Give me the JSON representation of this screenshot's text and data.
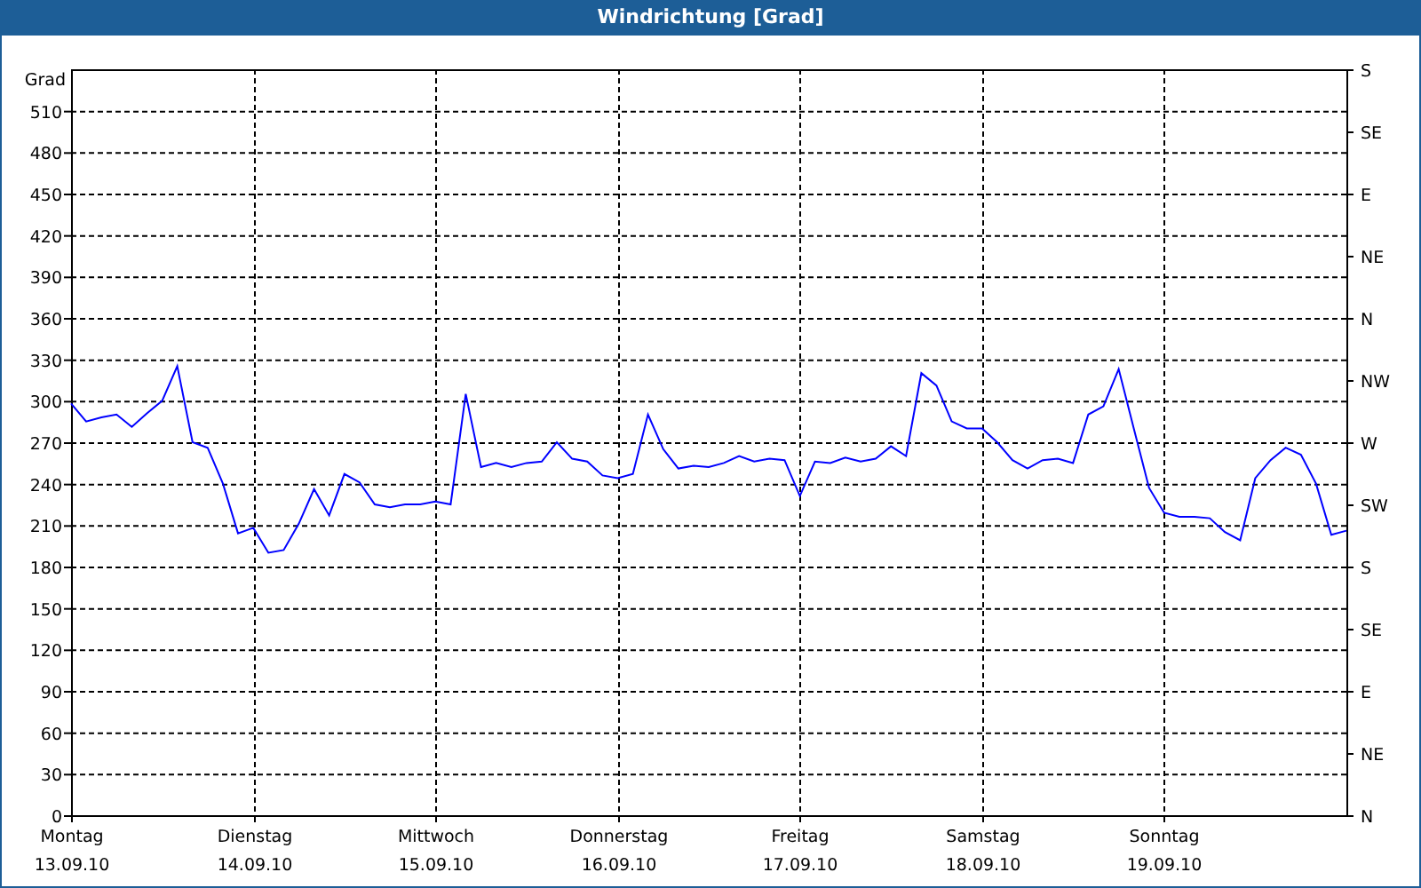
{
  "window": {
    "title": "Windrichtung [Grad]"
  },
  "chart": {
    "chart_data": {
      "type": "line",
      "grid": true,
      "ylabel": "Grad",
      "ylim": [
        0,
        540
      ],
      "yticks": [
        0,
        30,
        60,
        90,
        120,
        150,
        180,
        210,
        240,
        270,
        300,
        330,
        360,
        390,
        420,
        450,
        480,
        510
      ],
      "categories": [
        "Montag\n13.09.10",
        null,
        null,
        null,
        null,
        null,
        null,
        null,
        null,
        null,
        null,
        null,
        "Dienstag\n14.09.10",
        null,
        null,
        null,
        null,
        null,
        null,
        null,
        null,
        null,
        null,
        null,
        "Mittwoch\n15.09.10",
        null,
        null,
        null,
        null,
        null,
        null,
        null,
        null,
        null,
        null,
        null,
        "Donnerstag\n16.09.10",
        null,
        null,
        null,
        null,
        null,
        null,
        null,
        null,
        null,
        null,
        null,
        "Freitag\n17.09.10",
        null,
        null,
        null,
        null,
        null,
        null,
        null,
        null,
        null,
        null,
        null,
        "Samstag\n18.09.10",
        null,
        null,
        null,
        null,
        null,
        null,
        null,
        null,
        null,
        null,
        null,
        "Sonntag\n19.09.10",
        null,
        null,
        null,
        null,
        null,
        null,
        null,
        null,
        null,
        null,
        null,
        null
      ],
      "series": [
        {
          "color": "#0000ff",
          "values": [
            298,
            285,
            288,
            290,
            281,
            291,
            300,
            325,
            270,
            266,
            240,
            204,
            208,
            190,
            192,
            211,
            236,
            217,
            247,
            241,
            225,
            223,
            225,
            225,
            227,
            225,
            305,
            252,
            255,
            252,
            255,
            256,
            270,
            258,
            256,
            246,
            244,
            247,
            290,
            265,
            251,
            253,
            252,
            255,
            260,
            256,
            258,
            257,
            231,
            256,
            255,
            259,
            256,
            258,
            267,
            260,
            320,
            311,
            285,
            280,
            280,
            270,
            257,
            251,
            257,
            258,
            255,
            290,
            296,
            323,
            280,
            237,
            219,
            216,
            216,
            215,
            205,
            199,
            244,
            257,
            266,
            261,
            240,
            203,
            206
          ]
        }
      ]
    },
    "right_axis": {
      "labels": [
        "S",
        "SE",
        "E",
        "NE",
        "N",
        "NW",
        "W",
        "SW",
        "S",
        "SE",
        "E",
        "NE",
        "N"
      ]
    }
  }
}
